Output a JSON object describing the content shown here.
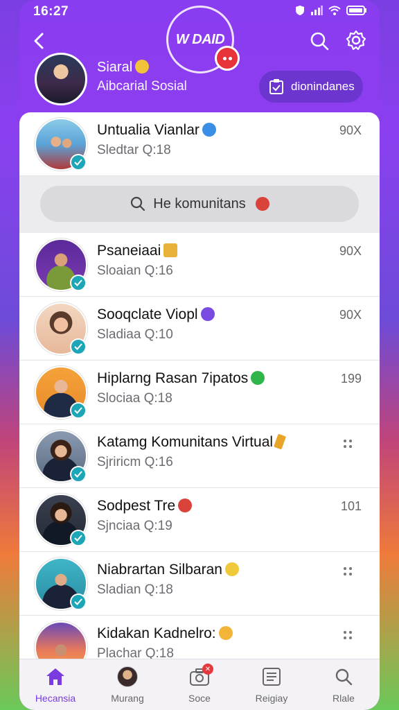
{
  "status": {
    "time": "16:27"
  },
  "header": {
    "logo_text": "W DAID",
    "profile_name": "Siaral",
    "profile_sub": "Aibcarial Sosial",
    "pill_label": "dionindanes"
  },
  "search": {
    "placeholder": "He komunitans"
  },
  "rows": [
    {
      "title": "Untualia Vianlar",
      "sub": "Sledtar  Q:18",
      "meta": "90X",
      "emoji_color": "#3a8ee6"
    },
    {
      "title": "Psaneiaai",
      "sub": "Sloaian  Q:16",
      "meta": "90X",
      "emoji_color": "#e8b23a"
    },
    {
      "title": "Sooqclate Viopl",
      "sub": "Sladiaa  Q:10",
      "meta": "90X",
      "emoji_color": "#7a4be0"
    },
    {
      "title": "Hiplarng Rasan 7ipatos",
      "sub": "Slociaa  Q:18",
      "meta": "199",
      "emoji_color": "#2fb54a"
    },
    {
      "title": "Katamg Komunitans Virtual",
      "sub": "Sjriricm  Q:16",
      "meta": "",
      "emoji_color": "#e8a52a"
    },
    {
      "title": "Sodpest Tre",
      "sub": "Sjnciaa  Q:19",
      "meta": "101",
      "emoji_color": "#d9433a"
    },
    {
      "title": "Niabrartan Silbaran",
      "sub": "Sladian  Q:18",
      "meta": "",
      "emoji_color": "#f0c93a"
    },
    {
      "title": "Kidakan Kadnelro:",
      "sub": "Plachar  Q:18",
      "meta": "",
      "emoji_color": "#f2b53a"
    }
  ],
  "nav": [
    {
      "label": "Hecansia"
    },
    {
      "label": "Murang"
    },
    {
      "label": "Soce"
    },
    {
      "label": "Reigiay"
    },
    {
      "label": "Rlale"
    }
  ],
  "colors": {
    "accent": "#7a3be0",
    "check": "#1ca6b7",
    "badge": "#e5393d"
  }
}
